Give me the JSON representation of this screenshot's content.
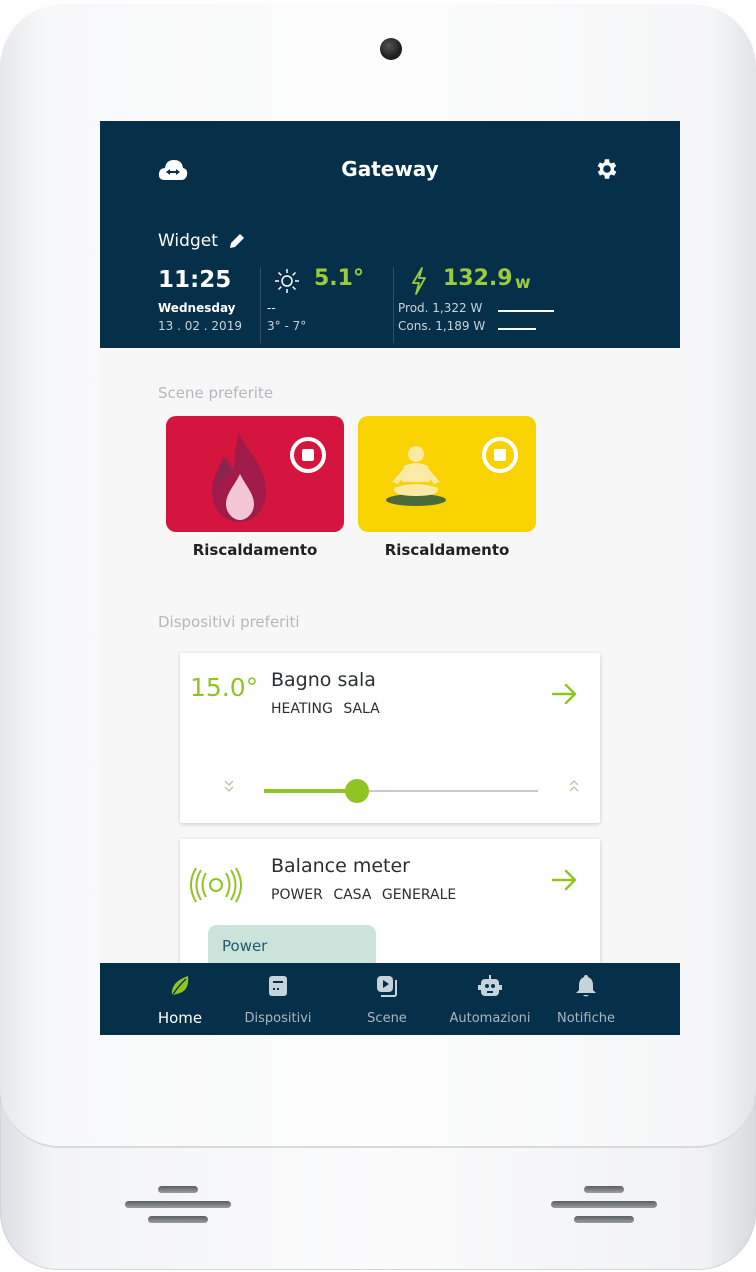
{
  "header": {
    "title": "Gateway",
    "cloud_icon": "cloud-sync-icon",
    "settings_icon": "gear-icon"
  },
  "widget": {
    "label": "Widget",
    "time": "11:25",
    "day": "Wednesday",
    "date": "13 . 02 . 2019",
    "weather": {
      "temperature": "5.1°",
      "condition": "--",
      "range": "3° - 7°"
    },
    "energy": {
      "power_value": "132.9",
      "power_unit": "w",
      "production": "Prod.  1,322 W",
      "consumption": "Cons.  1,189 W"
    }
  },
  "favorite_scenes": {
    "label": "Scene preferite",
    "items": [
      {
        "name": "Riscaldamento",
        "color": "#d5153d",
        "icon": "flame-drop-icon"
      },
      {
        "name": "Riscaldamento",
        "color": "#f8d300",
        "icon": "meditation-icon"
      }
    ]
  },
  "favorite_devices": {
    "label": "Dispositivi preferiti",
    "items": [
      {
        "value": "15.0°",
        "name": "Bagno sala",
        "tags": "HEATING SALA",
        "slider_level": 0.34
      },
      {
        "name": "Balance meter",
        "tags": "POWER CASA GENERALE",
        "chip": "Power"
      }
    ]
  },
  "navbar": {
    "items": [
      {
        "label": "Home",
        "icon": "leaf-icon",
        "active": true
      },
      {
        "label": "Dispositivi",
        "icon": "device-icon"
      },
      {
        "label": "Scene",
        "icon": "scene-icon"
      },
      {
        "label": "Automazioni",
        "icon": "robot-icon"
      },
      {
        "label": "Notifiche",
        "icon": "bell-icon"
      }
    ]
  },
  "colors": {
    "primary": "#063049",
    "accent": "#8fc425",
    "scene_red": "#d5153d",
    "scene_yellow": "#f8d300"
  }
}
